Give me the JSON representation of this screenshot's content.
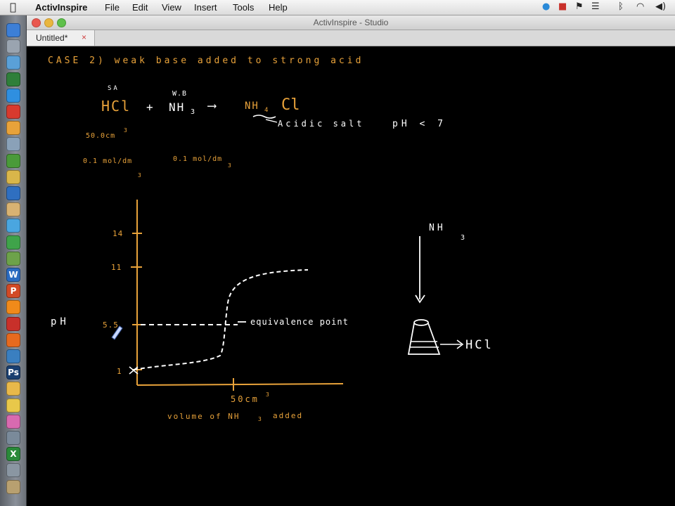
{
  "menubar": {
    "app_name": "ActivInspire",
    "menus": [
      "File",
      "Edit",
      "View",
      "Insert",
      "Tools",
      "Help"
    ],
    "apple_icon": "apple-icon",
    "tray_icons": [
      "skype-icon",
      "pdf-icon",
      "flag-icon",
      "list-icon",
      "bluetooth-icon",
      "wifi-icon",
      "volume-icon"
    ]
  },
  "window": {
    "title": "ActivInspire - Studio"
  },
  "tabs": [
    {
      "label": "Untitled*",
      "close": "×"
    }
  ],
  "dock": {
    "icons": [
      {
        "name": "finder-icon",
        "color": "#3d7fd6",
        "glyph": ""
      },
      {
        "name": "rocket-icon",
        "color": "#9aa4b0",
        "glyph": ""
      },
      {
        "name": "photos-icon",
        "color": "#5aa0d8",
        "glyph": ""
      },
      {
        "name": "facetime-icon",
        "color": "#2f7f3a",
        "glyph": ""
      },
      {
        "name": "appstore-icon",
        "color": "#2f8fe0",
        "glyph": ""
      },
      {
        "name": "calendar-icon",
        "color": "#d83a2e",
        "glyph": ""
      },
      {
        "name": "image-icon",
        "color": "#e8a23a",
        "glyph": ""
      },
      {
        "name": "preview-icon",
        "color": "#8aa1b8",
        "glyph": ""
      },
      {
        "name": "chart-icon",
        "color": "#4a9a3a",
        "glyph": ""
      },
      {
        "name": "star-icon",
        "color": "#d9b64a",
        "glyph": ""
      },
      {
        "name": "globe-icon",
        "color": "#2f6fc0",
        "glyph": ""
      },
      {
        "name": "lion-icon",
        "color": "#d8b272",
        "glyph": ""
      },
      {
        "name": "safari-icon",
        "color": "#4aa6e0",
        "glyph": ""
      },
      {
        "name": "chrome-icon",
        "color": "#3fa34a",
        "glyph": ""
      },
      {
        "name": "map-icon",
        "color": "#6da24a",
        "glyph": ""
      },
      {
        "name": "word-icon",
        "color": "#2a6bc0",
        "glyph": "W"
      },
      {
        "name": "powerpoint-icon",
        "color": "#d24a26",
        "glyph": "P"
      },
      {
        "name": "vlc-icon",
        "color": "#f08a1a",
        "glyph": ""
      },
      {
        "name": "pdf-reader-icon",
        "color": "#c8302a",
        "glyph": ""
      },
      {
        "name": "firefox-icon",
        "color": "#e66a1f",
        "glyph": ""
      },
      {
        "name": "network-icon",
        "color": "#3a7fc0",
        "glyph": ""
      },
      {
        "name": "photoshop-icon",
        "color": "#1a3f70",
        "glyph": "Ps"
      },
      {
        "name": "sketch-icon",
        "color": "#e8b84a",
        "glyph": ""
      },
      {
        "name": "pencil-icon",
        "color": "#e8c84a",
        "glyph": ""
      },
      {
        "name": "colorsync-icon",
        "color": "#d86ab0",
        "glyph": ""
      },
      {
        "name": "misc-icon",
        "color": "#7a8a9a",
        "glyph": ""
      },
      {
        "name": "excel-icon",
        "color": "#2a8a3a",
        "glyph": "X"
      },
      {
        "name": "tools-icon",
        "color": "#8a96a2",
        "glyph": ""
      },
      {
        "name": "scripts-icon",
        "color": "#b8a070",
        "glyph": ""
      }
    ]
  },
  "board": {
    "heading": "CASE 2) weak base added to strong acid",
    "reaction": {
      "label_strong_acid": "SA",
      "label_weak_base": "W.B",
      "hcl": "HCl",
      "plus": "+",
      "nh3": "NH",
      "nh3_sub": "3",
      "arrow": "⟶",
      "product": "NH",
      "product_sub": "4",
      "product_tail": "Cl",
      "note": "Acidic salt",
      "ph_note": "pH < 7"
    },
    "volume": "50.0cm",
    "volume_sup": "3",
    "conc_acid": "0.1 mol/dm",
    "conc_acid_sup": "3",
    "conc_base": "0.1 mol/dm",
    "conc_base_sup": "3",
    "graph": {
      "y_label": "pH",
      "x_label": "volume of NH",
      "x_label_sub": "3",
      "x_label_tail": "added",
      "x_tick_label": "50cm",
      "x_tick_sup": "3",
      "y_ticks": [
        "14",
        "11",
        "5.5",
        "1"
      ],
      "equivalence_label": "equivalence point"
    },
    "flask": {
      "reagent_top": "NH",
      "reagent_top_sub": "3",
      "reagent_in": "HCl"
    },
    "colors": {
      "orange": "#e8a23a",
      "white": "#ffffff"
    }
  }
}
